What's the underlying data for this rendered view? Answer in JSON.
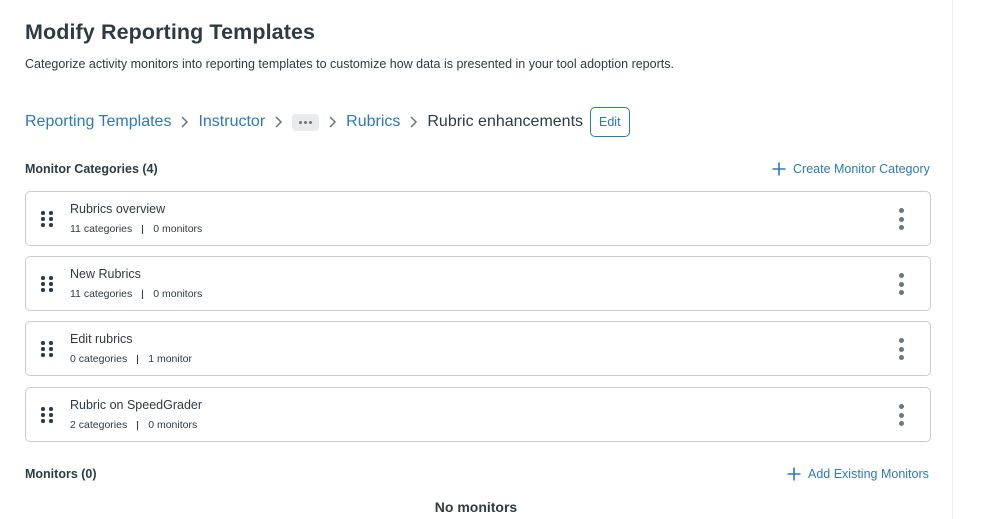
{
  "header": {
    "title": "Modify Reporting Templates",
    "subtitle": "Categorize activity monitors into reporting templates to customize how data is presented in your tool adoption reports."
  },
  "breadcrumb": {
    "items": [
      "Reporting Templates",
      "Instructor",
      "Rubrics"
    ],
    "ellipsis_icon": "ellipsis-icon",
    "current": "Rubric enhancements",
    "edit_label": "Edit"
  },
  "categories_section": {
    "heading": "Monitor Categories (4)",
    "create_label": "Create Monitor Category",
    "cards": [
      {
        "title": "Rubrics overview",
        "categories": "11 categories",
        "monitors": "0 monitors"
      },
      {
        "title": "New Rubrics",
        "categories": "11 categories",
        "monitors": "0 monitors"
      },
      {
        "title": "Edit rubrics",
        "categories": "0 categories",
        "monitors": "1 monitor"
      },
      {
        "title": "Rubric on SpeedGrader",
        "categories": "2 categories",
        "monitors": "0 monitors"
      }
    ]
  },
  "monitors_section": {
    "heading": "Monitors (0)",
    "add_label": "Add Existing Monitors",
    "empty_text": "No monitors"
  },
  "colors": {
    "link": "#2b7abc",
    "text": "#2d3b45",
    "border": "#c7cdd1"
  }
}
